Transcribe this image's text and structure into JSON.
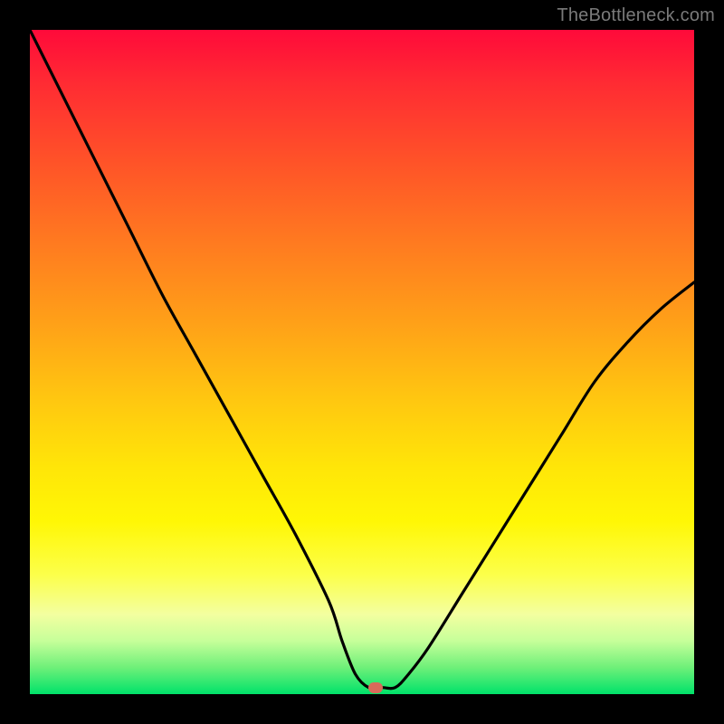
{
  "watermark": "TheBottleneck.com",
  "chart_data": {
    "type": "line",
    "title": "",
    "xlabel": "",
    "ylabel": "",
    "xlim": [
      0,
      100
    ],
    "ylim": [
      0,
      100
    ],
    "grid": false,
    "series": [
      {
        "name": "curve",
        "x": [
          0,
          5,
          10,
          15,
          20,
          25,
          30,
          35,
          40,
          45,
          47,
          49,
          51,
          53,
          55,
          57,
          60,
          65,
          70,
          75,
          80,
          85,
          90,
          95,
          100
        ],
        "y": [
          100,
          90,
          80,
          70,
          60,
          51,
          42,
          33,
          24,
          14,
          8,
          3,
          1,
          1,
          1,
          3,
          7,
          15,
          23,
          31,
          39,
          47,
          53,
          58,
          62
        ]
      }
    ],
    "marker": {
      "x": 52,
      "y": 1,
      "color": "#d86a5a"
    },
    "gradient_stops": [
      {
        "pos": 0,
        "color": "#ff0a3a"
      },
      {
        "pos": 20,
        "color": "#ff5328"
      },
      {
        "pos": 44,
        "color": "#ffa018"
      },
      {
        "pos": 66,
        "color": "#ffe608"
      },
      {
        "pos": 88,
        "color": "#f3ffa0"
      },
      {
        "pos": 100,
        "color": "#00e26a"
      }
    ]
  }
}
